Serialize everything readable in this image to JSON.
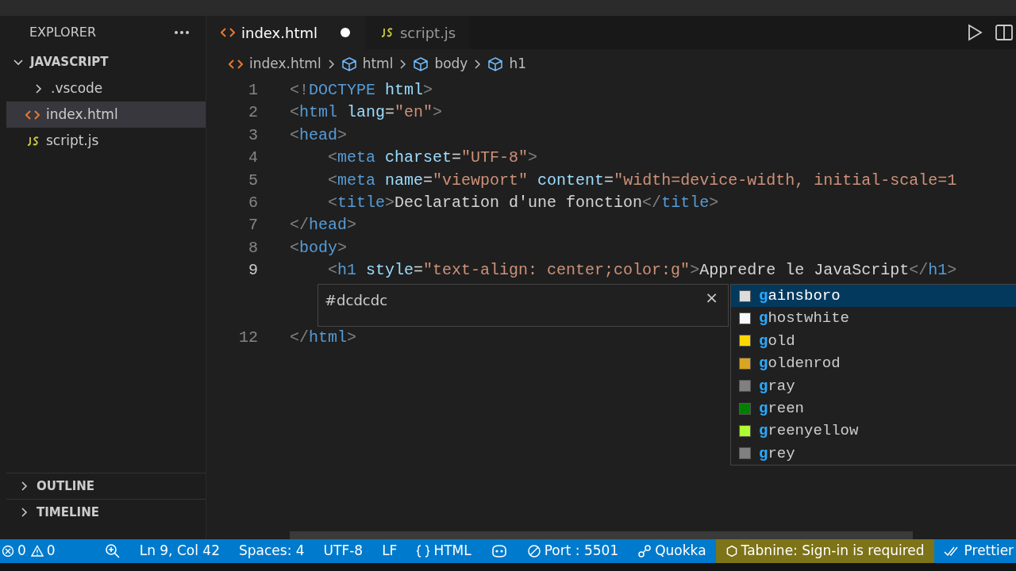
{
  "sidebar": {
    "title": "EXPLORER",
    "root": {
      "label": "JAVASCRIPT",
      "expanded": true,
      "children": [
        {
          "label": ".vscode",
          "kind": "folder",
          "expanded": false,
          "selected": false
        },
        {
          "label": "index.html",
          "kind": "html",
          "selected": true
        },
        {
          "label": "script.js",
          "kind": "js",
          "selected": false
        }
      ]
    },
    "panels": [
      {
        "label": "OUTLINE",
        "expanded": false
      },
      {
        "label": "TIMELINE",
        "expanded": false
      }
    ]
  },
  "tabs": [
    {
      "label": "index.html",
      "kind": "html",
      "selected": true,
      "modified": true
    },
    {
      "label": "script.js",
      "kind": "js",
      "selected": false,
      "modified": false
    }
  ],
  "breadcrumbs": [
    {
      "label": "index.html",
      "kind": "file"
    },
    {
      "label": "html",
      "kind": "element"
    },
    {
      "label": "body",
      "kind": "element"
    },
    {
      "label": "h1",
      "kind": "element"
    }
  ],
  "code": {
    "lines": [
      {
        "number": "1",
        "tokens": [
          {
            "kind": "punct",
            "text": "<!"
          },
          {
            "kind": "tag",
            "text": "DOCTYPE"
          },
          {
            "kind": "attr",
            "text": " html"
          },
          {
            "kind": "punct",
            "text": ">"
          }
        ]
      },
      {
        "number": "2",
        "tokens": [
          {
            "kind": "punct",
            "text": "<"
          },
          {
            "kind": "tag",
            "text": "html"
          },
          {
            "kind": "attr",
            "text": " lang"
          },
          {
            "kind": "text",
            "text": "="
          },
          {
            "kind": "string",
            "text": "\"en\""
          },
          {
            "kind": "punct",
            "text": ">"
          }
        ]
      },
      {
        "number": "3",
        "tokens": [
          {
            "kind": "punct",
            "text": "<"
          },
          {
            "kind": "tag",
            "text": "head"
          },
          {
            "kind": "punct",
            "text": ">"
          }
        ]
      },
      {
        "number": "4",
        "tokens": [
          {
            "kind": "punct",
            "text": "    <"
          },
          {
            "kind": "tag",
            "text": "meta"
          },
          {
            "kind": "attr",
            "text": " charset"
          },
          {
            "kind": "text",
            "text": "="
          },
          {
            "kind": "string",
            "text": "\"UTF-8\""
          },
          {
            "kind": "punct",
            "text": ">"
          }
        ]
      },
      {
        "number": "5",
        "tokens": [
          {
            "kind": "punct",
            "text": "    <"
          },
          {
            "kind": "tag",
            "text": "meta"
          },
          {
            "kind": "attr",
            "text": " name"
          },
          {
            "kind": "text",
            "text": "="
          },
          {
            "kind": "string",
            "text": "\"viewport\""
          },
          {
            "kind": "attr",
            "text": " content"
          },
          {
            "kind": "text",
            "text": "="
          },
          {
            "kind": "string",
            "text": "\"width=device-width, initial-scale=1"
          }
        ]
      },
      {
        "number": "6",
        "tokens": [
          {
            "kind": "punct",
            "text": "    <"
          },
          {
            "kind": "tag",
            "text": "title"
          },
          {
            "kind": "punct",
            "text": ">"
          },
          {
            "kind": "text",
            "text": "Declaration d'une fonction"
          },
          {
            "kind": "punct",
            "text": "</"
          },
          {
            "kind": "tag",
            "text": "title"
          },
          {
            "kind": "punct",
            "text": ">"
          }
        ]
      },
      {
        "number": "7",
        "tokens": [
          {
            "kind": "punct",
            "text": "</"
          },
          {
            "kind": "tag",
            "text": "head"
          },
          {
            "kind": "punct",
            "text": ">"
          }
        ]
      },
      {
        "number": "8",
        "tokens": [
          {
            "kind": "punct",
            "text": "<"
          },
          {
            "kind": "tag",
            "text": "body"
          },
          {
            "kind": "punct",
            "text": ">"
          }
        ]
      },
      {
        "number": "9",
        "tokens": [
          {
            "kind": "punct",
            "text": "    <"
          },
          {
            "kind": "tag",
            "text": "h1"
          },
          {
            "kind": "attr",
            "text": " style"
          },
          {
            "kind": "text",
            "text": "="
          },
          {
            "kind": "string",
            "text": "\"text-align: center;color:g\""
          },
          {
            "kind": "punct",
            "text": ">"
          },
          {
            "kind": "text",
            "text": "Appredre le JavaScript"
          },
          {
            "kind": "punct",
            "text": "</"
          },
          {
            "kind": "tag",
            "text": "h1"
          },
          {
            "kind": "punct",
            "text": ">"
          }
        ]
      },
      {
        "kind": "hidden"
      },
      {
        "kind": "hidden"
      },
      {
        "number": "12",
        "tokens": [
          {
            "kind": "punct",
            "text": "</"
          },
          {
            "kind": "tag",
            "text": "html"
          },
          {
            "kind": "punct",
            "text": ">"
          }
        ]
      }
    ]
  },
  "hover": {
    "text": "#dcdcdc",
    "close": "×"
  },
  "suggestions": [
    {
      "label": "**g**ainsboro",
      "color": "#dcdcdc",
      "selected": true
    },
    {
      "label": "**g**hostwhite",
      "color": "#f8f8ff",
      "selected": false
    },
    {
      "label": "**g**old",
      "color": "#ffd700",
      "selected": false
    },
    {
      "label": "**g**oldenrod",
      "color": "#daa520",
      "selected": false
    },
    {
      "label": "**g**ray",
      "color": "#808080",
      "selected": false
    },
    {
      "label": "**g**reen",
      "color": "#008000",
      "selected": false
    },
    {
      "label": "**g**reenyellow",
      "color": "#adff2f",
      "selected": false
    },
    {
      "label": "**g**rey",
      "color": "#808080",
      "selected": false
    }
  ],
  "status_bar": [
    {
      "kind": "errors",
      "text": "0"
    },
    {
      "kind": "warnings",
      "text": "0"
    },
    {
      "kind": "zoom"
    },
    {
      "kind": "plain",
      "text": "Ln 9, Col 42"
    },
    {
      "kind": "plain",
      "text": "Spaces: 4"
    },
    {
      "kind": "plain",
      "text": "UTF-8"
    },
    {
      "kind": "plain",
      "text": "LF"
    },
    {
      "kind": "language",
      "text": "HTML"
    },
    {
      "kind": "copilot"
    },
    {
      "kind": "port",
      "text": "Port : 5501"
    },
    {
      "kind": "quokka",
      "text": "Quokka"
    },
    {
      "kind": "warning-area",
      "text": "Tabnine: Sign-in is required"
    },
    {
      "kind": "prettier",
      "text": "Prettier"
    }
  ]
}
